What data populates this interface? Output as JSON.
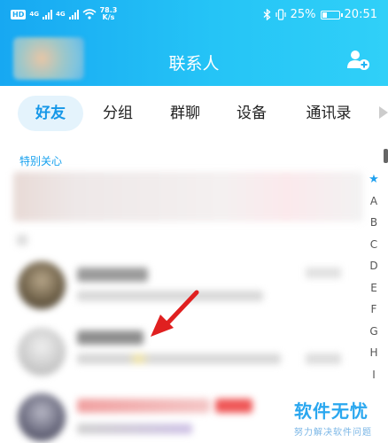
{
  "status_bar": {
    "hd": "HD",
    "network1": "4G",
    "network2": "4G",
    "speed_value": "78.3",
    "speed_unit": "K/s",
    "battery": "25%",
    "time": "20:51"
  },
  "header": {
    "title": "联系人"
  },
  "tabs": [
    {
      "label": "好友",
      "active": true
    },
    {
      "label": "分组"
    },
    {
      "label": "群聊"
    },
    {
      "label": "设备"
    },
    {
      "label": "通讯录"
    }
  ],
  "section": {
    "label": "特别关心"
  },
  "index": [
    "★",
    "A",
    "B",
    "C",
    "D",
    "E",
    "F",
    "G",
    "H",
    "I"
  ],
  "watermark": {
    "title": "软件无忧",
    "subtitle": "努力解决软件问题"
  },
  "colors": {
    "header": "#1eb3f4",
    "accent": "#1597e8",
    "arrow": "#e02020"
  }
}
